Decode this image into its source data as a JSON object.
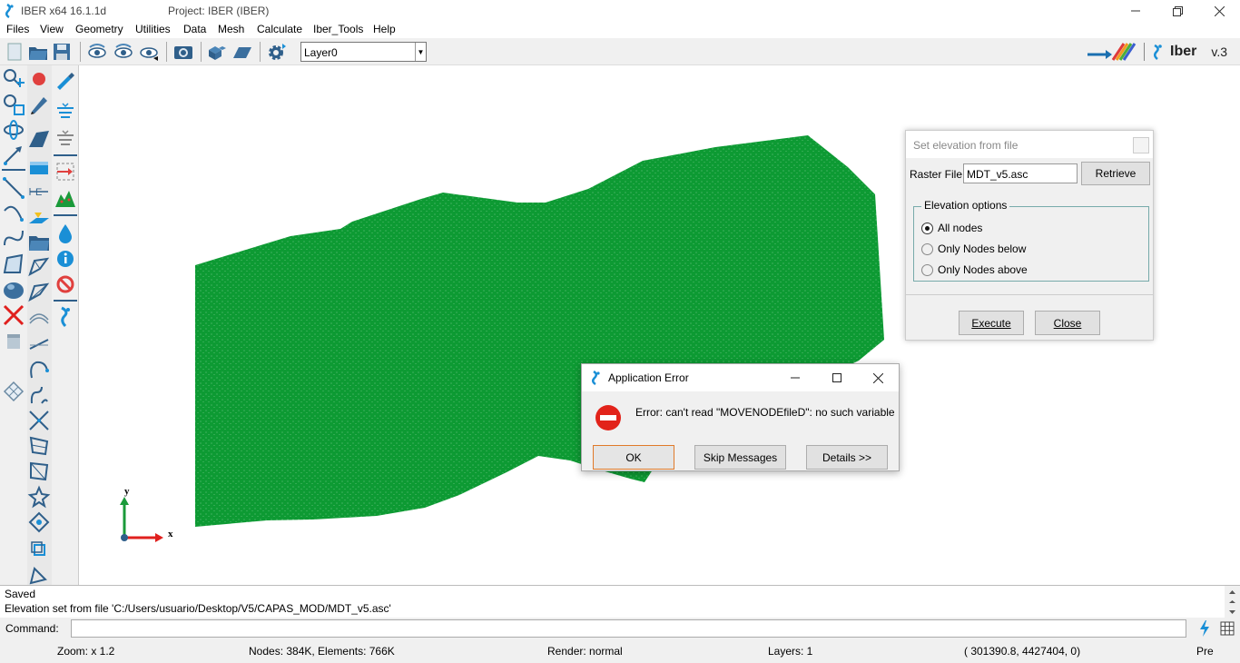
{
  "window": {
    "app_title": "IBER x64 16.1.1d",
    "project_title": "Project: IBER (IBER)"
  },
  "menu": [
    "Files",
    "View",
    "Geometry",
    "Utilities",
    "Data",
    "Mesh",
    "Calculate",
    "Iber_Tools",
    "Help"
  ],
  "toolbar": {
    "layer_value": "Layer0",
    "brand_name": "Iber",
    "brand_version": "v.3"
  },
  "viewport": {
    "mesh_color": "#0d9a33",
    "axis": {
      "y_label": "y",
      "x_label": "x"
    }
  },
  "log": {
    "lines": [
      "Saved",
      "Elevation set from file 'C:/Users/usuario/Desktop/V5/CAPAS_MOD/MDT_v5.asc'"
    ]
  },
  "command": {
    "label": "Command:",
    "value": ""
  },
  "status": {
    "zoom": "Zoom: x 1.2",
    "nodes": "Nodes: 384K, Elements: 766K",
    "render": "Render: normal",
    "layers": "Layers: 1",
    "coords": "( 301390.8,  4427404,  0)",
    "mode": "Pre"
  },
  "set_elevation_dialog": {
    "title": "Set elevation from file",
    "raster_label": "Raster File:",
    "raster_value": "MDT_v5.asc",
    "retrieve": "Retrieve",
    "group_title": "Elevation options",
    "options": [
      "All nodes",
      "Only Nodes below",
      "Only Nodes above"
    ],
    "selected": "All nodes",
    "execute": "Execute",
    "close": "Close"
  },
  "error_dialog": {
    "title": "Application Error",
    "message": "Error: can't read \"MOVENODEfileD\": no such variable",
    "ok": "OK",
    "skip": "Skip Messages",
    "details": "Details >>"
  }
}
